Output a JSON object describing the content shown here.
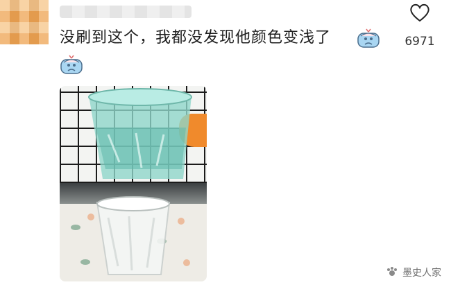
{
  "comment": {
    "avatar_icon": "avatar-icon",
    "text": "没刷到这个，我都没发现他颜色变浅了",
    "emoji_icon": "crying-face-emoji-icon"
  },
  "like": {
    "icon": "heart-outline-icon",
    "count": "6971"
  },
  "photo": {
    "description_icon": "glass-cup-photo"
  },
  "watermark": {
    "icon": "paw-icon",
    "text": "墨史人家"
  },
  "colors": {
    "glass_tint": "#8fd6c9",
    "tablecloth": "#eeece6"
  }
}
